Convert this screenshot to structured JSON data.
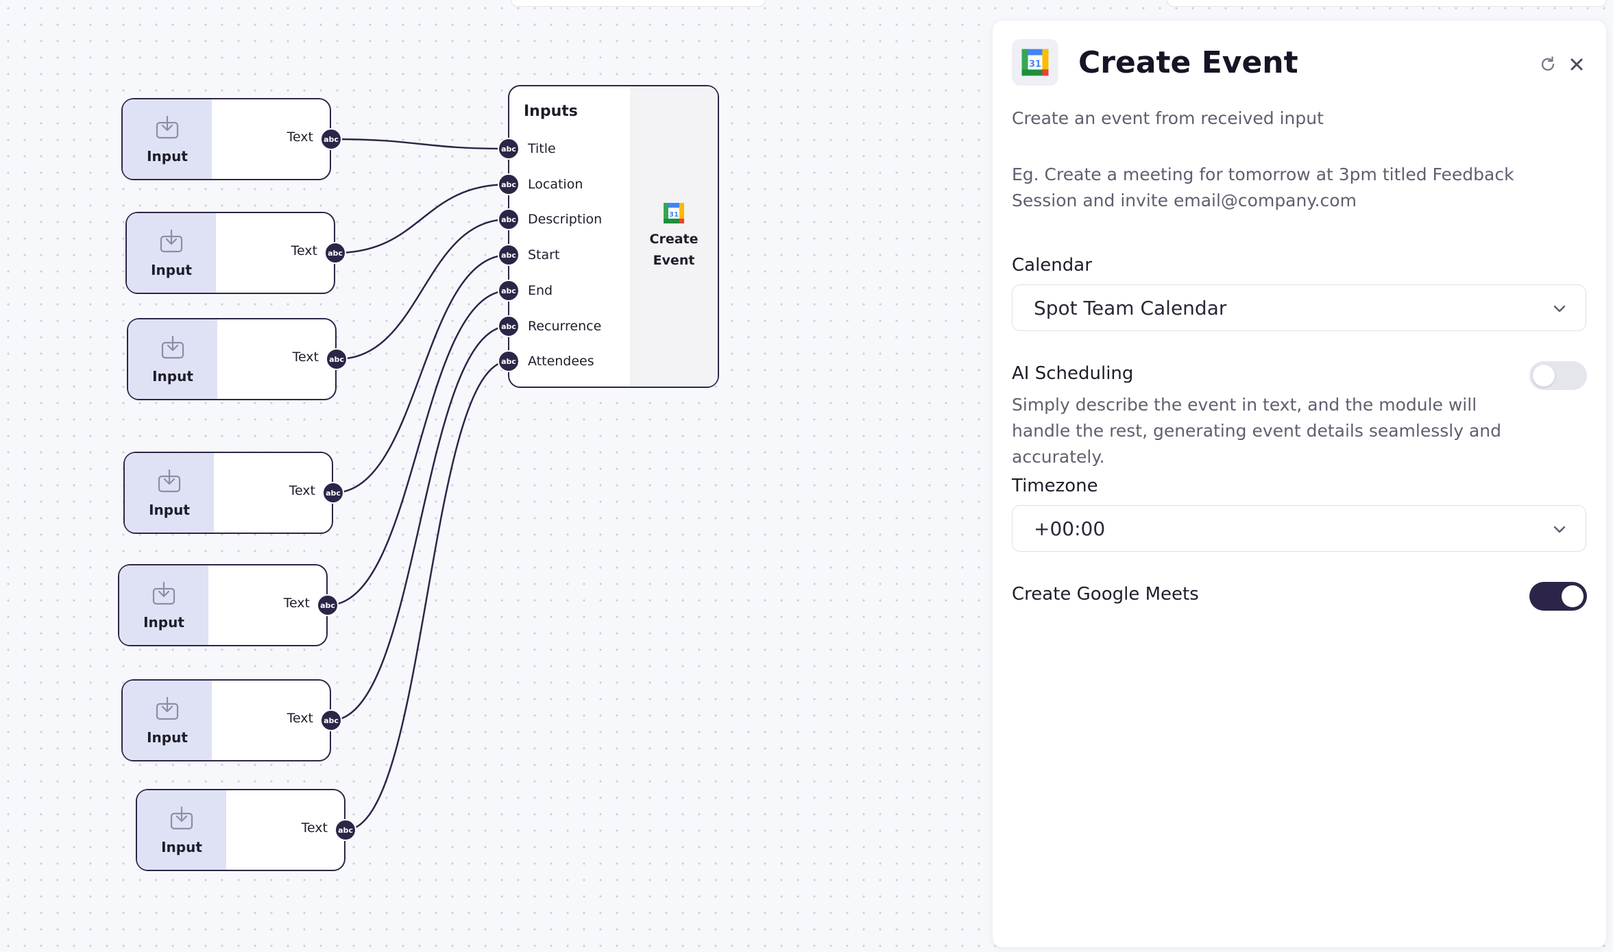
{
  "colors": {
    "accent": "#2d2548",
    "input_fill": "#dfe2f4",
    "canvas": "#f7f8fb"
  },
  "input_nodes": [
    {
      "label": "Input",
      "output_label": "Text",
      "port_type": "abc"
    },
    {
      "label": "Input",
      "output_label": "Text",
      "port_type": "abc"
    },
    {
      "label": "Input",
      "output_label": "Text",
      "port_type": "abc"
    },
    {
      "label": "Input",
      "output_label": "Text",
      "port_type": "abc"
    },
    {
      "label": "Input",
      "output_label": "Text",
      "port_type": "abc"
    },
    {
      "label": "Input",
      "output_label": "Text",
      "port_type": "abc"
    },
    {
      "label": "Input",
      "output_label": "Text",
      "port_type": "abc"
    }
  ],
  "event_node": {
    "header": "Inputs",
    "title": "Create Event",
    "icon": "google-calendar-icon",
    "fields": [
      {
        "label": "Title",
        "port_type": "abc"
      },
      {
        "label": "Location",
        "port_type": "abc"
      },
      {
        "label": "Description",
        "port_type": "abc"
      },
      {
        "label": "Start",
        "port_type": "abc"
      },
      {
        "label": "End",
        "port_type": "abc"
      },
      {
        "label": "Recurrence",
        "port_type": "abc"
      },
      {
        "label": "Attendees",
        "port_type": "abc"
      }
    ]
  },
  "panel": {
    "title": "Create Event",
    "icon": "google-calendar-icon",
    "description": "Create an event from received input",
    "example": "Eg. Create a meeting for tomorrow at 3pm titled Feedback Session and invite email@company.com",
    "calendar": {
      "label": "Calendar",
      "value": "Spot Team Calendar"
    },
    "ai_scheduling": {
      "label": "AI Scheduling",
      "enabled": false,
      "help": "Simply describe the event in text, and the module will handle the rest, generating event details seamlessly and accurately."
    },
    "timezone": {
      "label": "Timezone",
      "value": "+00:00"
    },
    "google_meets": {
      "label": "Create Google Meets",
      "enabled": true
    },
    "header_icons": [
      "refresh-icon",
      "close-icon"
    ]
  }
}
